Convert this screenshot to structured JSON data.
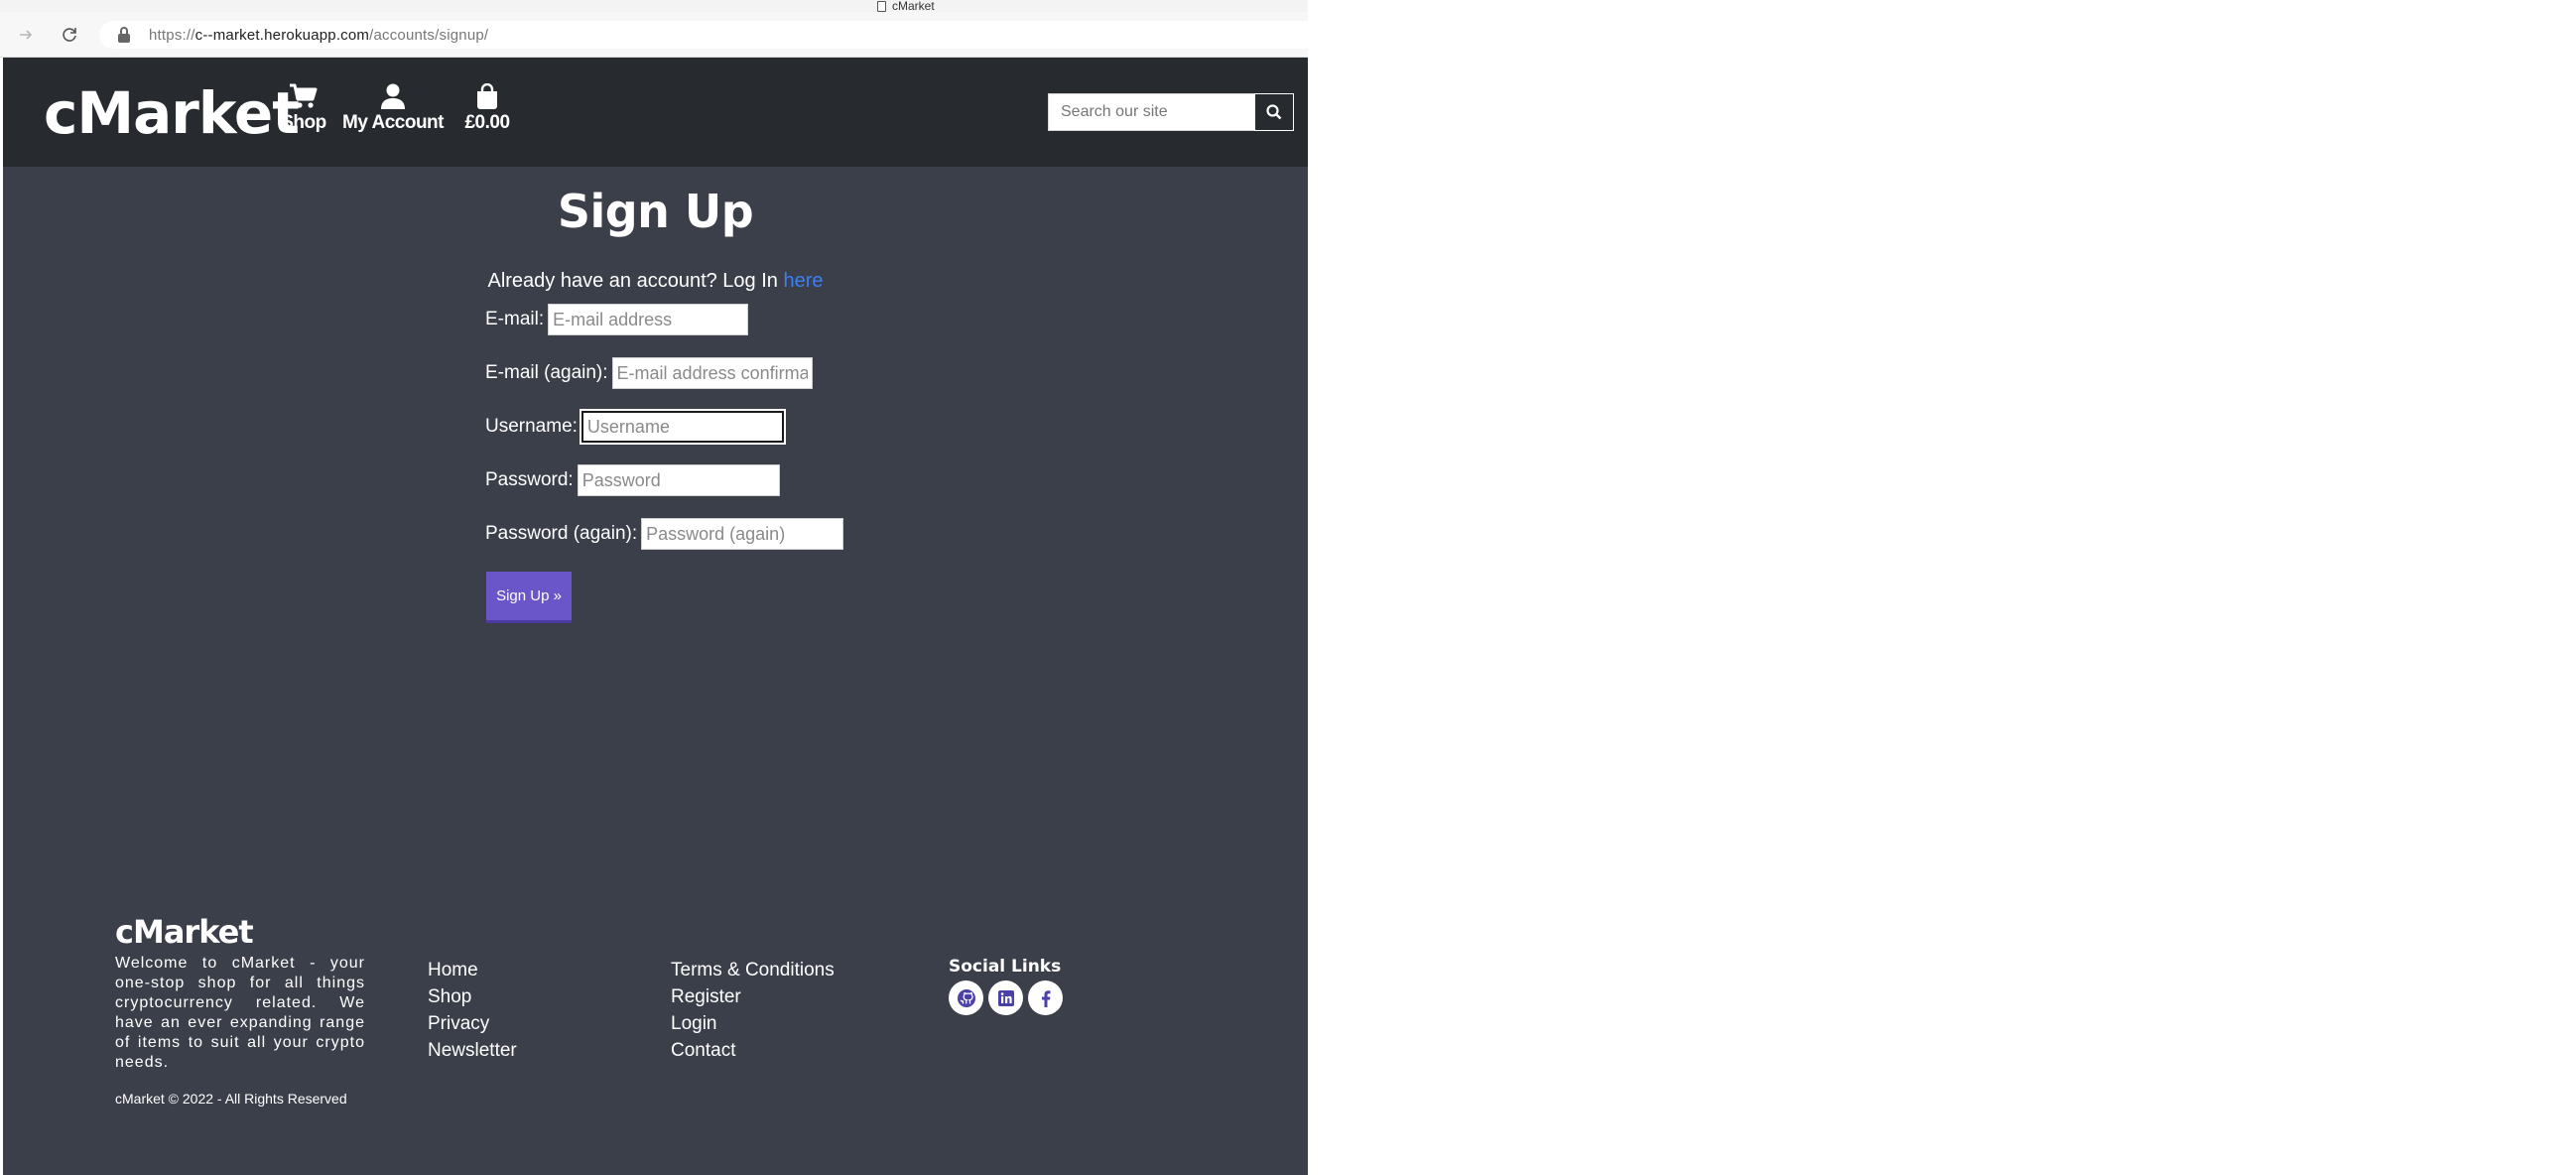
{
  "browser": {
    "tab_title": "cMarket",
    "url_prefix": "https://",
    "url_host": "c--market.herokuapp.com",
    "url_path": "/accounts/signup/"
  },
  "header": {
    "logo": "cMarket",
    "nav": {
      "shop": "Shop",
      "account": "My Account",
      "bag": "£0.00"
    },
    "search": {
      "placeholder": "Search our site"
    }
  },
  "signup": {
    "title": "Sign Up",
    "login_prefix": "Already have an account? Log In ",
    "login_link": "here",
    "fields": {
      "email": {
        "label": "E-mail:",
        "placeholder": "E-mail address"
      },
      "email2": {
        "label": "E-mail (again):",
        "placeholder": "E-mail address confirmation"
      },
      "username": {
        "label": "Username:",
        "placeholder": "Username"
      },
      "password": {
        "label": "Password:",
        "placeholder": "Password"
      },
      "password2": {
        "label": "Password (again):",
        "placeholder": "Password (again)"
      }
    },
    "submit": "Sign Up »"
  },
  "footer": {
    "logo": "cMarket",
    "about": "Welcome to cMarket - your one-stop shop for all things cryptocurrency related. We have an ever expanding range of items to suit all your crypto needs.",
    "copyright": "cMarket © 2022 - All Rights Reserved",
    "links_col1": [
      "Home",
      "Shop",
      "Privacy",
      "Newsletter"
    ],
    "links_col2": [
      "Terms & Conditions",
      "Register",
      "Login",
      "Contact"
    ],
    "social_title": "Social Links",
    "social_icons": [
      "github-icon",
      "linkedin-icon",
      "facebook-icon"
    ]
  },
  "colors": {
    "header_bg": "#272a2f",
    "page_bg": "#3b3f4a",
    "link": "#3d7ff5",
    "button": "#6b56c9"
  }
}
